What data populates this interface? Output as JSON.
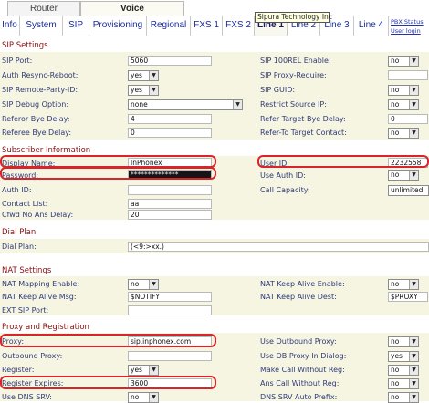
{
  "top_tabs": {
    "router": "Router",
    "voice": "Voice"
  },
  "tooltip": "Sipura Technology Inc",
  "sub_tabs": [
    "Info",
    "System",
    "SIP",
    "Provisioning",
    "Regional",
    "FXS 1",
    "FXS 2",
    "Line 1",
    "Line 2",
    "Line 3",
    "Line 4"
  ],
  "active_sub_tab": "Line 1",
  "links": {
    "pbx_status": "PBX Status",
    "user_login": "User login"
  },
  "colors": {
    "section_title": "#8a0f10",
    "label": "#2e3a78",
    "band": "#f6f5e2",
    "highlight": "#d8242a"
  },
  "sip_settings": {
    "title": "SIP Settings",
    "sip_port": {
      "label": "SIP Port:",
      "value": "5060"
    },
    "sip_100rel": {
      "label": "SIP 100REL Enable:",
      "value": "no"
    },
    "auth_resync": {
      "label": "Auth Resync-Reboot:",
      "value": "yes"
    },
    "sip_proxy_require": {
      "label": "SIP Proxy-Require:",
      "value": ""
    },
    "sip_remote_party_id": {
      "label": "SIP Remote-Party-ID:",
      "value": "yes"
    },
    "sip_guid": {
      "label": "SIP GUID:",
      "value": "no"
    },
    "sip_debug": {
      "label": "SIP Debug Option:",
      "value": "none"
    },
    "restrict_source_ip": {
      "label": "Restrict Source IP:",
      "value": "no"
    },
    "referor_bye_delay": {
      "label": "Referor Bye Delay:",
      "value": "4"
    },
    "refer_target_bye_delay": {
      "label": "Refer Target Bye Delay:",
      "value": "0"
    },
    "referee_bye_delay": {
      "label": "Referee Bye Delay:",
      "value": "0"
    },
    "refer_to_target_contact": {
      "label": "Refer-To Target Contact:",
      "value": "no"
    }
  },
  "subscriber": {
    "title": "Subscriber Information",
    "display_name": {
      "label": "Display Name:",
      "value": "InPhonex"
    },
    "user_id": {
      "label": "User ID:",
      "value": "2232558"
    },
    "password": {
      "label": "Password:",
      "value": "**************"
    },
    "use_auth_id": {
      "label": "Use Auth ID:",
      "value": "no"
    },
    "auth_id": {
      "label": "Auth ID:",
      "value": ""
    },
    "call_capacity": {
      "label": "Call Capacity:",
      "value": "unlimited"
    },
    "contact_list": {
      "label": "Contact List:",
      "value": "aa"
    },
    "cfwd_no_ans_delay": {
      "label": "Cfwd No Ans Delay:",
      "value": "20"
    }
  },
  "dial_plan": {
    "title": "Dial Plan",
    "dial_plan": {
      "label": "Dial Plan:",
      "value": "(<9:>xx.)"
    }
  },
  "nat": {
    "title": "NAT Settings",
    "nat_mapping_enable": {
      "label": "NAT Mapping Enable:",
      "value": "no"
    },
    "nat_keep_alive_enable": {
      "label": "NAT Keep Alive Enable:",
      "value": "no"
    },
    "nat_keep_alive_msg": {
      "label": "NAT Keep Alive Msg:",
      "value": "$NOTIFY"
    },
    "nat_keep_alive_dest": {
      "label": "NAT Keep Alive Dest:",
      "value": "$PROXY"
    },
    "ext_sip_port": {
      "label": "EXT SIP Port:",
      "value": ""
    }
  },
  "proxy": {
    "title": "Proxy and Registration",
    "proxy": {
      "label": "Proxy:",
      "value": "sip.inphonex.com"
    },
    "use_outbound_proxy": {
      "label": "Use Outbound Proxy:",
      "value": "no"
    },
    "outbound_proxy": {
      "label": "Outbound Proxy:",
      "value": ""
    },
    "use_ob_proxy_in_dialog": {
      "label": "Use OB Proxy In Dialog:",
      "value": "yes"
    },
    "register": {
      "label": "Register:",
      "value": "yes"
    },
    "make_call_without_reg": {
      "label": "Make Call Without Reg:",
      "value": "no"
    },
    "register_expires": {
      "label": "Register Expires:",
      "value": "3600"
    },
    "ans_call_without_reg": {
      "label": "Ans Call Without Reg:",
      "value": "no"
    },
    "use_dns_srv": {
      "label": "Use DNS SRV:",
      "value": "no"
    },
    "dns_srv_auto_prefix": {
      "label": "DNS SRV Auto Prefix:",
      "value": "no"
    }
  }
}
